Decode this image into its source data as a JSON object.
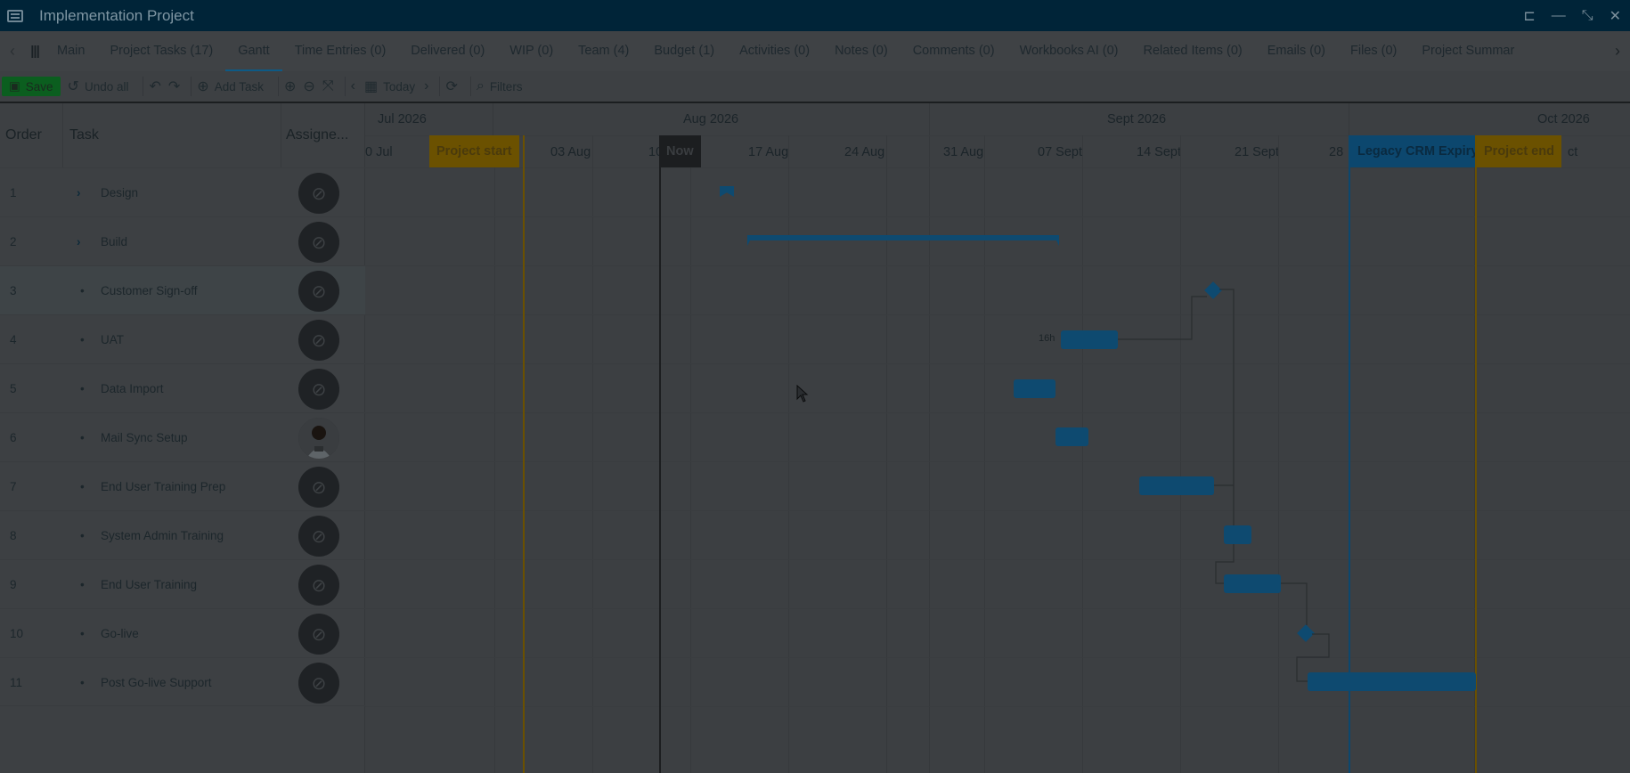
{
  "window": {
    "title": "Implementation Project"
  },
  "tabs": [
    {
      "label": "Main"
    },
    {
      "label": "Project Tasks (17)"
    },
    {
      "label": "Gantt"
    },
    {
      "label": "Time Entries (0)"
    },
    {
      "label": "Delivered (0)"
    },
    {
      "label": "WIP (0)"
    },
    {
      "label": "Team (4)"
    },
    {
      "label": "Budget (1)"
    },
    {
      "label": "Activities (0)"
    },
    {
      "label": "Notes (0)"
    },
    {
      "label": "Comments (0)"
    },
    {
      "label": "Workbooks AI (0)"
    },
    {
      "label": "Related Items (0)"
    },
    {
      "label": "Emails (0)"
    },
    {
      "label": "Files (0)"
    },
    {
      "label": "Project Summar"
    }
  ],
  "toolbar": {
    "save": "Save",
    "undo_all": "Undo all",
    "add_task": "Add Task",
    "today": "Today",
    "filters": "Filters"
  },
  "grid": {
    "headers": {
      "order": "Order",
      "task": "Task",
      "assignee": "Assigne..."
    },
    "rows": [
      {
        "order": "1",
        "name": "Design",
        "expandable": true,
        "avatar": "none"
      },
      {
        "order": "2",
        "name": "Build",
        "expandable": true,
        "avatar": "none"
      },
      {
        "order": "3",
        "name": "Customer Sign-off",
        "expandable": false,
        "avatar": "none"
      },
      {
        "order": "4",
        "name": "UAT",
        "expandable": false,
        "avatar": "none"
      },
      {
        "order": "5",
        "name": "Data Import",
        "expandable": false,
        "avatar": "none"
      },
      {
        "order": "6",
        "name": "Mail Sync Setup",
        "expandable": false,
        "avatar": "photo"
      },
      {
        "order": "7",
        "name": "End User Training Prep",
        "expandable": false,
        "avatar": "none"
      },
      {
        "order": "8",
        "name": "System Admin Training",
        "expandable": false,
        "avatar": "none"
      },
      {
        "order": "9",
        "name": "End User Training",
        "expandable": false,
        "avatar": "none"
      },
      {
        "order": "10",
        "name": "Go-live",
        "expandable": false,
        "avatar": "none"
      },
      {
        "order": "11",
        "name": "Post Go-live Support",
        "expandable": false,
        "avatar": "none"
      }
    ]
  },
  "timeline": {
    "months": [
      "Jul 2026",
      "Aug 2026",
      "Sept 2026",
      "Oct 2026"
    ],
    "weeks": [
      "0 Jul",
      "03 Aug",
      "10",
      "17 Aug",
      "24 Aug",
      "31 Aug",
      "07 Sept",
      "14 Sept",
      "21 Sept",
      "28",
      "ct"
    ],
    "markers": {
      "project_start": "Project start",
      "now": "Now",
      "legacy": "Legacy CRM Expiry",
      "project_end": "Project end"
    },
    "uat_label": "16h"
  },
  "colors": {
    "accent": "#0e4a70",
    "titlebar": "#002438",
    "marker_gold": "#7a5b00",
    "marker_blue": "#0d4a72"
  }
}
